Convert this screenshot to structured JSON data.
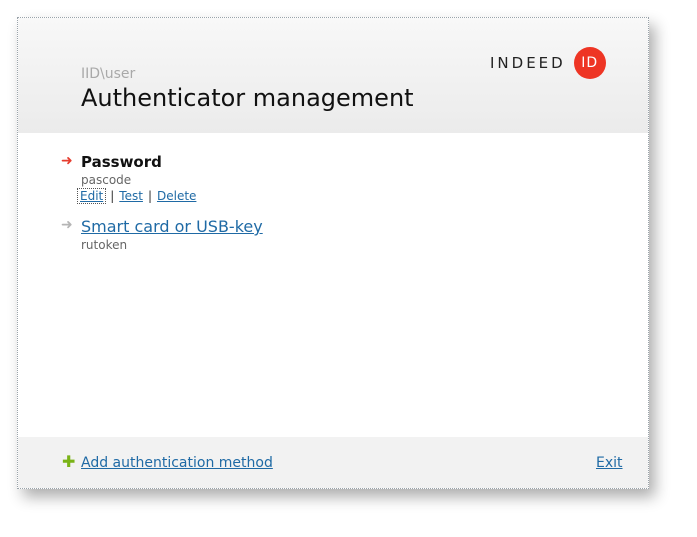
{
  "header": {
    "user": "IID\\user",
    "title": "Authenticator management",
    "logo_text": "INDEED",
    "logo_badge": "ID",
    "logo_color": "#ee3524"
  },
  "methods": [
    {
      "name": "Password",
      "subtitle": "pascode",
      "active": true,
      "arrow_icon": "right-arrow-icon",
      "actions": [
        "Edit",
        "Test",
        "Delete"
      ]
    },
    {
      "name": "Smart card or USB-key",
      "subtitle": "rutoken",
      "active": false,
      "arrow_icon": "right-arrow-icon"
    }
  ],
  "footer": {
    "add_icon": "plus-icon",
    "add_label": "Add authentication method",
    "exit_label": "Exit"
  },
  "colors": {
    "accent_red": "#e63c2e",
    "link_blue": "#1f6aa5",
    "plus_green": "#7ab317"
  }
}
